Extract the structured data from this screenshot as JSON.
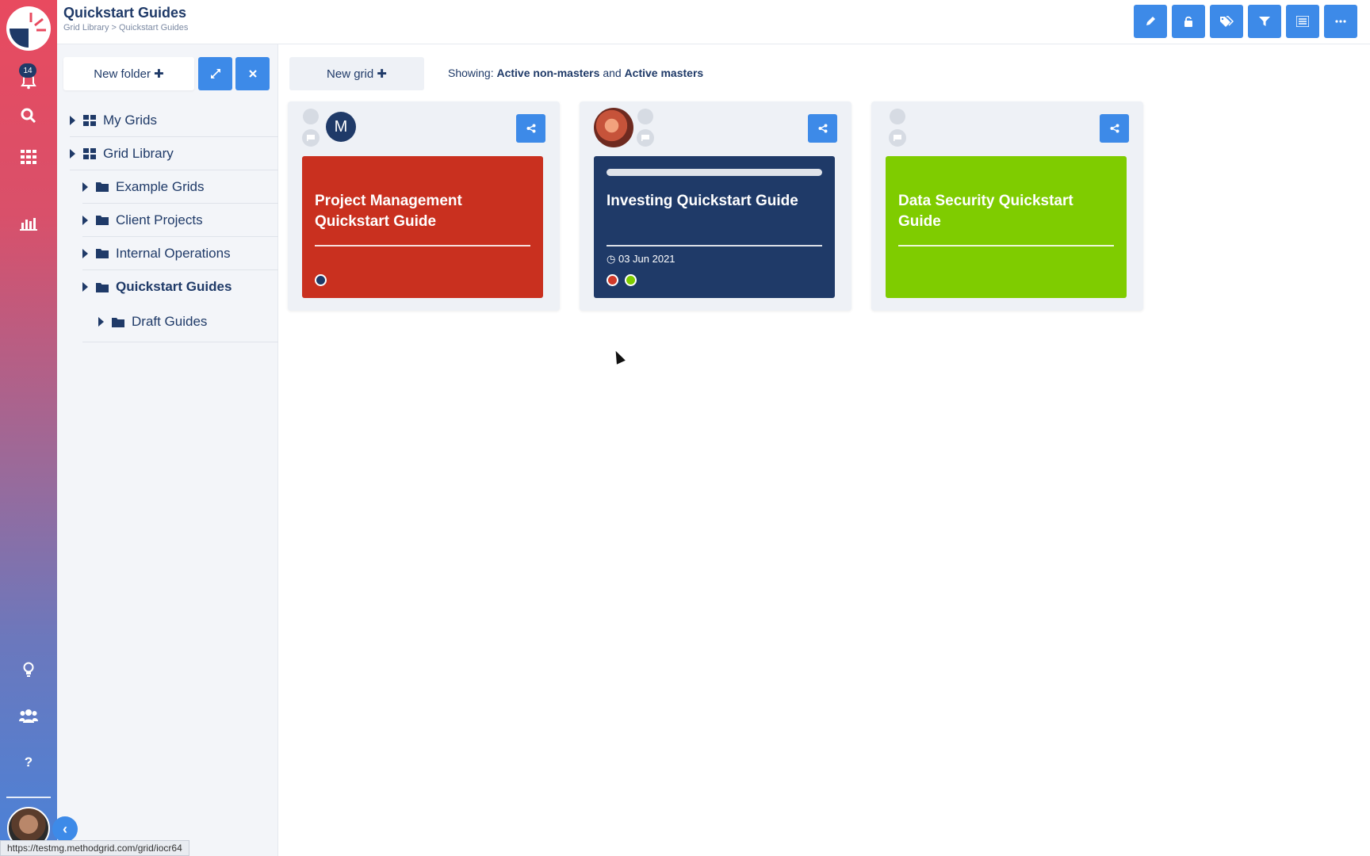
{
  "header": {
    "title": "Quickstart Guides",
    "breadcrumb": "Grid Library > Quickstart Guides",
    "toolbar": [
      "pencil-icon",
      "unlock-icon",
      "tags-icon",
      "filter-icon",
      "list-settings-icon",
      "more-icon"
    ]
  },
  "rail": {
    "notifications_count": "14",
    "icons": [
      "bell-icon",
      "search-icon",
      "grid-apps-icon",
      "chart-icon",
      "lightbulb-icon",
      "users-icon",
      "help-icon"
    ],
    "help_glyph": "?"
  },
  "sidebar": {
    "new_folder_label": "New folder ✚",
    "items": [
      {
        "label": "My Grids",
        "type": "grid"
      },
      {
        "label": "Grid Library",
        "type": "grid"
      },
      {
        "label": "Example Grids",
        "type": "folder"
      },
      {
        "label": "Client Projects",
        "type": "folder"
      },
      {
        "label": "Internal Operations",
        "type": "folder"
      },
      {
        "label": "Quickstart Guides",
        "type": "folder",
        "selected": true
      },
      {
        "label": "Draft Guides",
        "type": "folder"
      }
    ]
  },
  "main": {
    "new_grid_label": "New grid ✚",
    "showing_prefix": "Showing:",
    "filter_a": "Active non-masters",
    "and": "and",
    "filter_b": "Active masters",
    "cards": [
      {
        "title": "Project Management Quickstart Guide",
        "color": "#c9301f",
        "owner_initial": "M",
        "date": "",
        "dots": [
          "#1f3a68"
        ]
      },
      {
        "title": "Investing Quickstart Guide",
        "color": "#1f3a68",
        "owner_initial": "",
        "date": "03 Jun 2021",
        "dots": [
          "#d13a2a",
          "#7fcc00"
        ]
      },
      {
        "title": "Data Security Quickstart Guide",
        "color": "#7fcc00",
        "owner_initial": "",
        "date": "",
        "dots": []
      }
    ]
  },
  "status_url": "https://testmg.methodgrid.com/grid/iocr64"
}
